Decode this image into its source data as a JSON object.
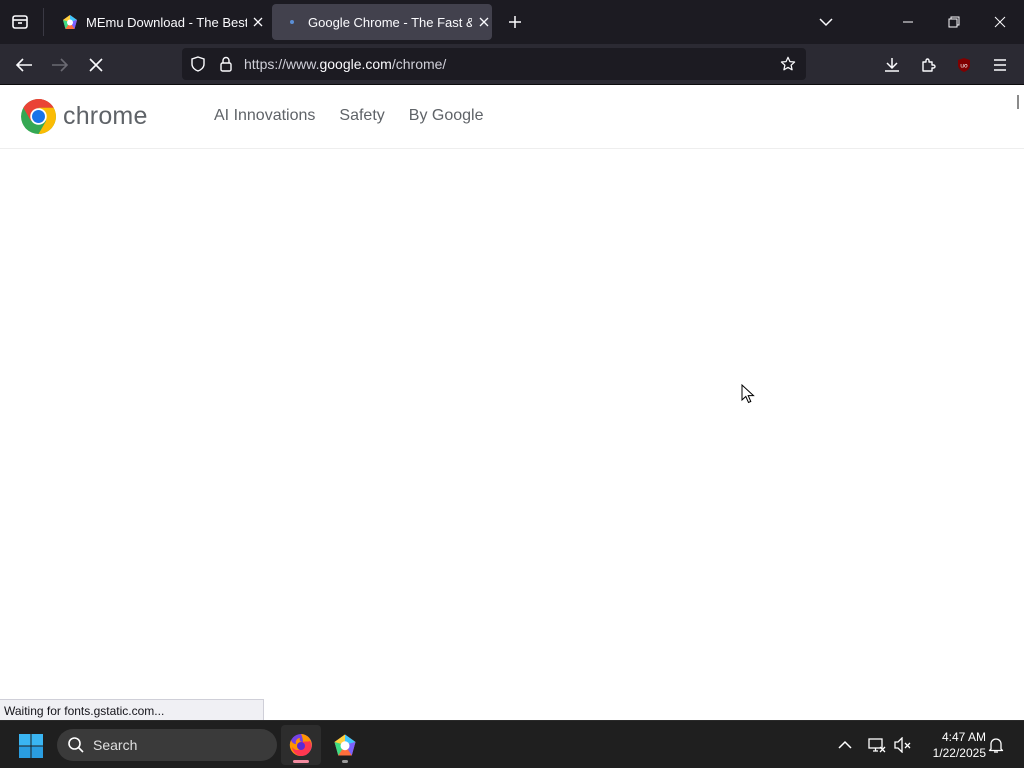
{
  "browser": {
    "tabs": [
      {
        "title": "MEmu Download - The Best Android Emulator",
        "active": false,
        "favicon": "memu-icon"
      },
      {
        "title": "Google Chrome - The Fast & Secure Browser",
        "active": true,
        "favicon": "google-chrome-favicon"
      }
    ],
    "url": {
      "prefix": "https://www.",
      "host": "google.com",
      "path": "/chrome/"
    },
    "status": "Waiting for fonts.gstatic.com..."
  },
  "page": {
    "logo_text": "chrome",
    "nav": [
      "AI Innovations",
      "Safety",
      "By Google"
    ]
  },
  "taskbar": {
    "search_label": "Search",
    "time": "4:47 AM",
    "date": "1/22/2025"
  },
  "colors": {
    "tabbar_bg": "#1c1b22",
    "toolbar_bg": "#2b2a33",
    "taskbar_bg": "#1f1f1f",
    "chrome_red": "#ea4335",
    "chrome_yellow": "#fbbc04",
    "chrome_green": "#34a853",
    "chrome_blue": "#1a73e8",
    "ublock_red": "#800000"
  }
}
